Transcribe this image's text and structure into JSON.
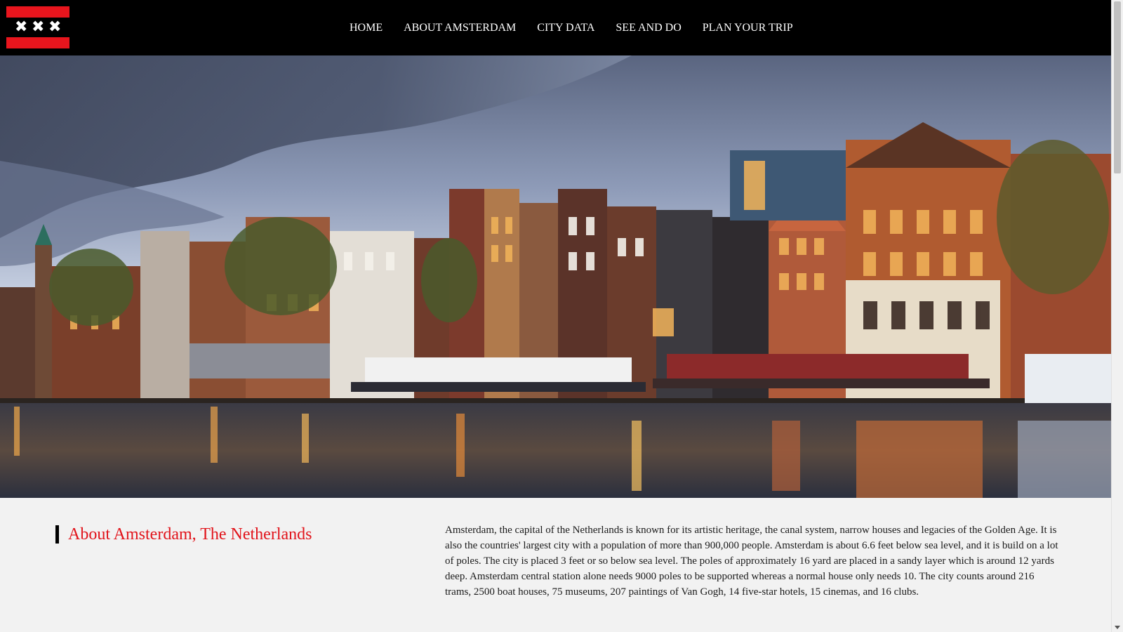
{
  "nav": {
    "logo_alt": "Amsterdam flag logo",
    "items": [
      {
        "label": "HOME"
      },
      {
        "label": "ABOUT AMSTERDAM"
      },
      {
        "label": "CITY DATA"
      },
      {
        "label": "SEE AND DO"
      },
      {
        "label": "PLAN YOUR TRIP"
      }
    ]
  },
  "hero": {
    "image_desc": "Amsterdam canal houses at dusk reflected in water"
  },
  "about": {
    "heading": "About Amsterdam, The Netherlands",
    "text": "Amsterdam, the capital of the Netherlands is known for its artistic heritage, the canal system, narrow houses and legacies of the Golden Age. It is also the countries' largest city with a population of more than 900,000 people. Amsterdam is about 6.6 feet below sea level, and it is build on a lot of poles. The city is placed 3 feet or so below sea level. The poles of approximately 16 yard are placed in a sandy layer which is around 12 yards deep. Amsterdam central station alone needs 9000 poles to be supported whereas a normal house only needs 10. The city counts around 216 trams, 2500 boat houses, 75 museums, 207 paintings of Van Gogh, 14 five-star hotels, 15 cinemas, and 16 clubs."
  },
  "colors": {
    "nav_bg": "#000000",
    "accent_red": "#e1131a",
    "page_bg": "#f2f2f2"
  }
}
